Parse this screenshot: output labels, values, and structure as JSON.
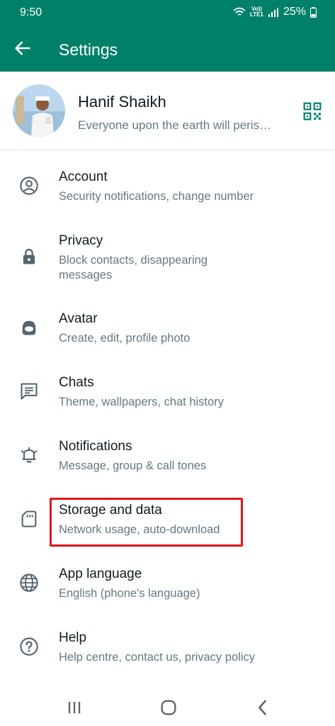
{
  "status_bar": {
    "time": "9:50",
    "volte": "Vo))",
    "lte": "LTE1",
    "battery": "25%"
  },
  "app_bar": {
    "title": "Settings"
  },
  "profile": {
    "name": "Hanif Shaikh",
    "about": "Everyone upon the earth will perish..."
  },
  "settings": [
    {
      "title": "Account",
      "subtitle": "Security notifications, change number"
    },
    {
      "title": "Privacy",
      "subtitle": "Block contacts, disappearing messages"
    },
    {
      "title": "Avatar",
      "subtitle": "Create, edit, profile photo"
    },
    {
      "title": "Chats",
      "subtitle": "Theme, wallpapers, chat history"
    },
    {
      "title": "Notifications",
      "subtitle": "Message, group & call tones"
    },
    {
      "title": "Storage and data",
      "subtitle": "Network usage, auto-download"
    },
    {
      "title": "App language",
      "subtitle": "English (phone's language)"
    },
    {
      "title": "Help",
      "subtitle": "Help centre, contact us, privacy policy"
    }
  ],
  "icons": {
    "account": "person-circle-icon",
    "privacy": "lock-icon",
    "avatar": "avatar-face-icon",
    "chats": "chat-bubble-icon",
    "notifications": "bell-icon",
    "storage": "sd-card-icon",
    "language": "globe-icon",
    "help": "help-circle-icon"
  },
  "colors": {
    "header": "#008069",
    "highlight": "#e3141b",
    "icon": "#54656f"
  }
}
